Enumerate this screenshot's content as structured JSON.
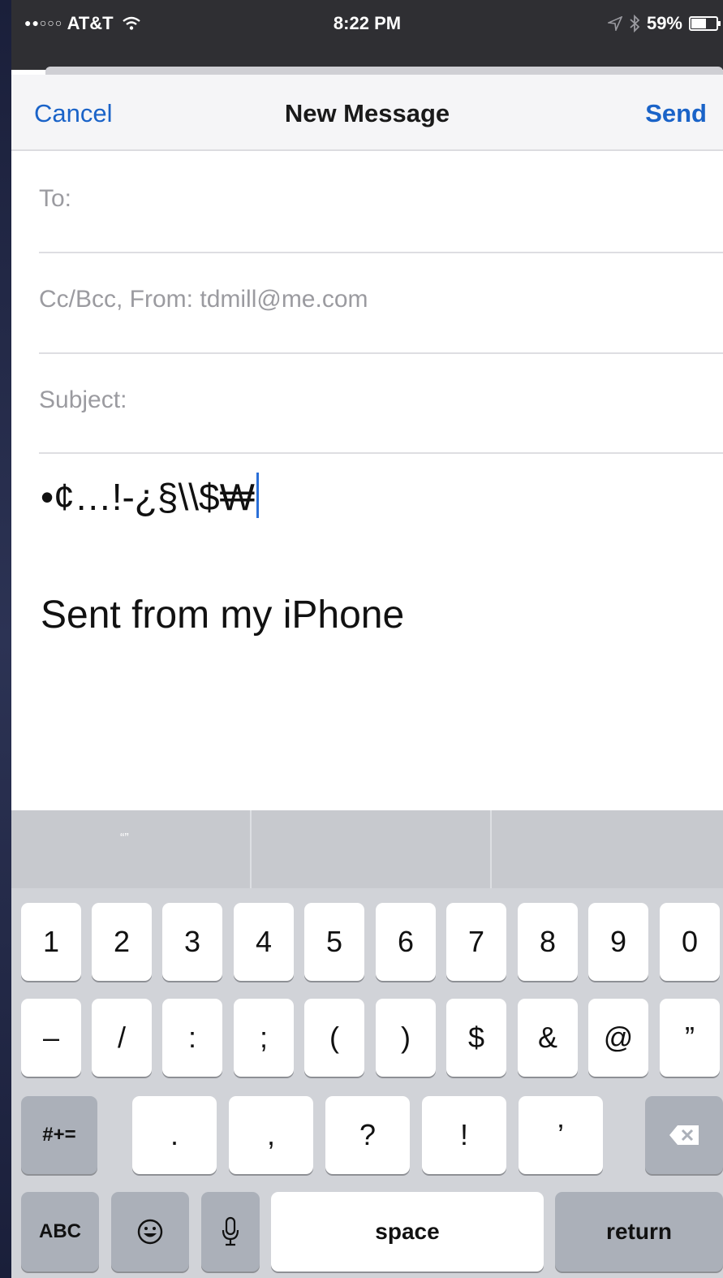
{
  "status_bar": {
    "signal_dots": "●●○○○",
    "carrier": "AT&T",
    "wifi_icon": "wifi-icon",
    "time": "8:22 PM",
    "location_icon": "location-arrow-icon",
    "bluetooth_icon": "bluetooth-icon",
    "battery": "59%",
    "battery_level": 0.59
  },
  "nav": {
    "cancel_label": "Cancel",
    "title": "New Message",
    "send_label": "Send"
  },
  "fields": {
    "to_label": "To:",
    "ccbcc_label": "Cc/Bcc, From:",
    "from_value": "tdmill@me.com",
    "subject_label": "Subject:"
  },
  "body": {
    "typed_text": "•¢…!-¿§\\\\$₩",
    "signature": "Sent from my iPhone"
  },
  "keyboard": {
    "suggestions": [
      "“”",
      "",
      ""
    ],
    "row1": [
      "1",
      "2",
      "3",
      "4",
      "5",
      "6",
      "7",
      "8",
      "9",
      "0"
    ],
    "row2": [
      "–",
      "/",
      ":",
      ";",
      "(",
      ")",
      "$",
      "&",
      "@",
      "”"
    ],
    "row3": {
      "shift_label": "#+=",
      "keys": [
        ".",
        ",",
        "?",
        "!",
        "’"
      ],
      "delete_icon": "backspace-icon"
    },
    "row4": {
      "abc_label": "ABC",
      "emoji_icon": "emoji-icon",
      "mic_icon": "microphone-icon",
      "space_label": "space",
      "return_label": "return"
    }
  },
  "colors": {
    "accent_blue": "#1a63c8",
    "status_bar_bg": "#2f2f33",
    "keyboard_bg": "#d1d3d8",
    "function_key": "#abb0b9"
  }
}
